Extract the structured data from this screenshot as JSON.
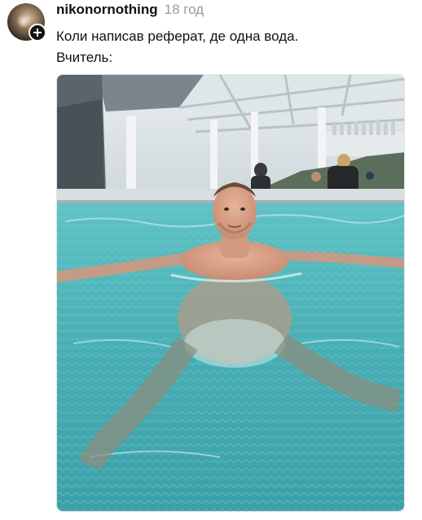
{
  "post": {
    "username": "nikonornothing",
    "timestamp": "18 год",
    "text_lines": [
      "Коли написав реферат, де одна вода.",
      "Вчитель:"
    ]
  },
  "colors": {
    "username": "#111111",
    "timestamp": "#9a9a9a",
    "pool_water": "#4fb3b8",
    "badge": "#111111"
  },
  "icons": {
    "follow_badge": "plus-icon"
  }
}
